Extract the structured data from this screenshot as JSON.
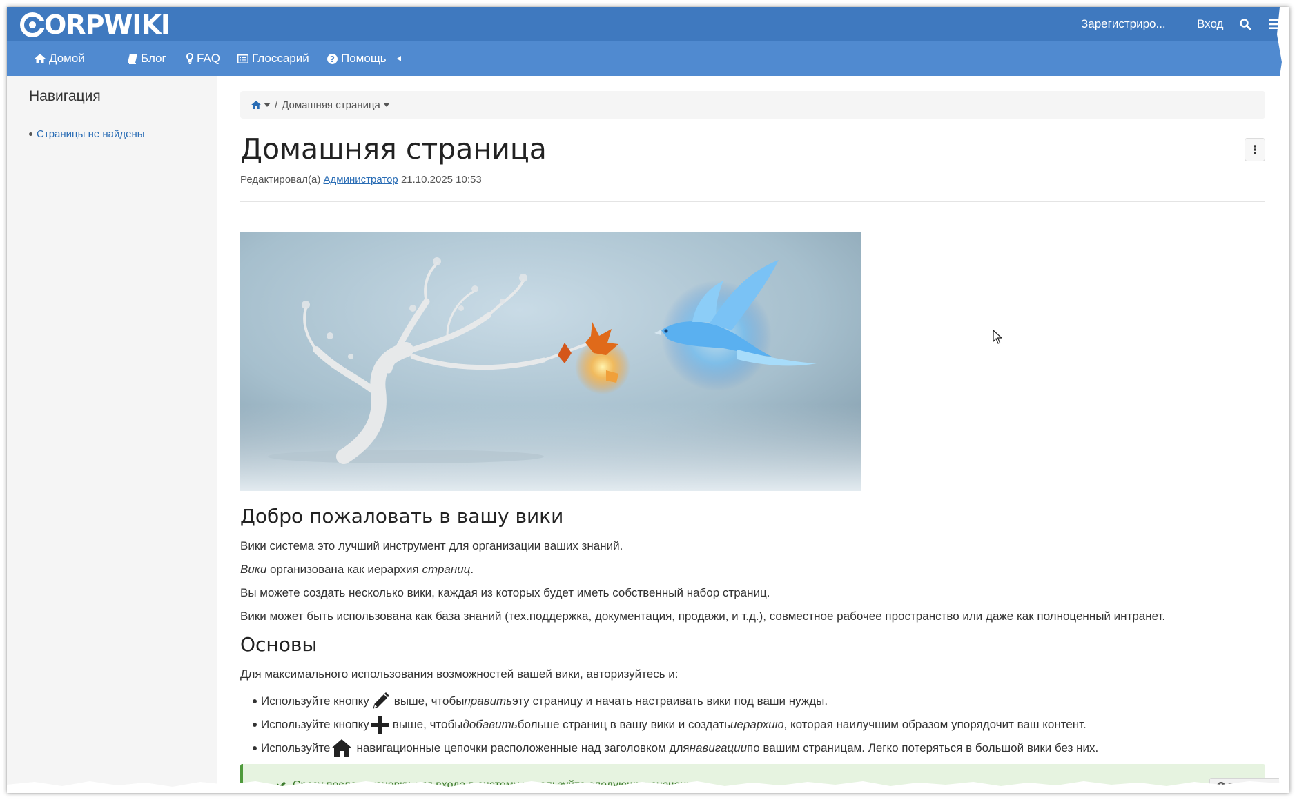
{
  "brand": {
    "logo_text": "ORPWIKI"
  },
  "topbar": {
    "register": "Зарегистриро...",
    "login": "Вход"
  },
  "nav": {
    "home": "Домой",
    "blog": "Блог",
    "faq": "FAQ",
    "glossary": "Глоссарий",
    "help": "Помощь"
  },
  "sidebar": {
    "title": "Навигация",
    "empty_item": "Страницы не найдены"
  },
  "breadcrumb": {
    "current": "Домашняя страница"
  },
  "page": {
    "title": "Домашняя страница",
    "edited_prefix": "Редактировал(а)",
    "edited_author": "Администратор",
    "edited_date": "21.10.2025 10:53"
  },
  "content": {
    "welcome_heading": "Добро пожаловать в вашу вики",
    "p1": "Вики система это лучший инструмент для организации ваших знаний.",
    "p2_a": "Вики",
    "p2_b": " организована как иерархия ",
    "p2_c": "страниц",
    "p2_d": ".",
    "p3": "Вы можете создать несколько вики, каждая из которых будет иметь собственный набор страниц.",
    "p4": "Вики может быть использована как база знаний (тех.поддержка, документация, продажи, и т.д.), совместное рабочее пространство или даже как полноценный интранет.",
    "basics_heading": "Основы",
    "p5": "Для максимального использования возможностей вашей вики, авторизуйтесь и:",
    "li1_a": "Используйте кнопку",
    "li1_b": " выше, чтобы ",
    "li1_c": "править",
    "li1_d": " эту страницу и начать настраивать вики под ваши нужды.",
    "li2_a": "Используйте кнопку",
    "li2_b": " выше, чтобы ",
    "li2_c": "добавить",
    "li2_d": " больше страниц в вашу вики и создать ",
    "li2_e": "иерархию",
    "li2_f": ", которая наилучшим образом упорядочит ваш контент.",
    "li3_a": "Используйте",
    "li3_b": " навигационные цепочки расположенные над заголовком для ",
    "li3_c": "навигации",
    "li3_d": " по вашим страницам. Легко потеряться в большой вики без них.",
    "alert": "Сразу после установки для входа в систему используйте следующие значения:"
  },
  "tour_button": "Показать тур",
  "colors": {
    "topbar": "#3f79bf",
    "navbar": "#508ad0",
    "link": "#2a6db5",
    "alert_bg": "#e6f3e0"
  },
  "icons": [
    "home-icon",
    "book-icon",
    "lightbulb-icon",
    "list-icon",
    "question-icon",
    "search-icon",
    "hamburger-icon",
    "pencil-icon",
    "plus-icon",
    "ellipsis-vertical-icon",
    "check-icon",
    "info-icon"
  ]
}
